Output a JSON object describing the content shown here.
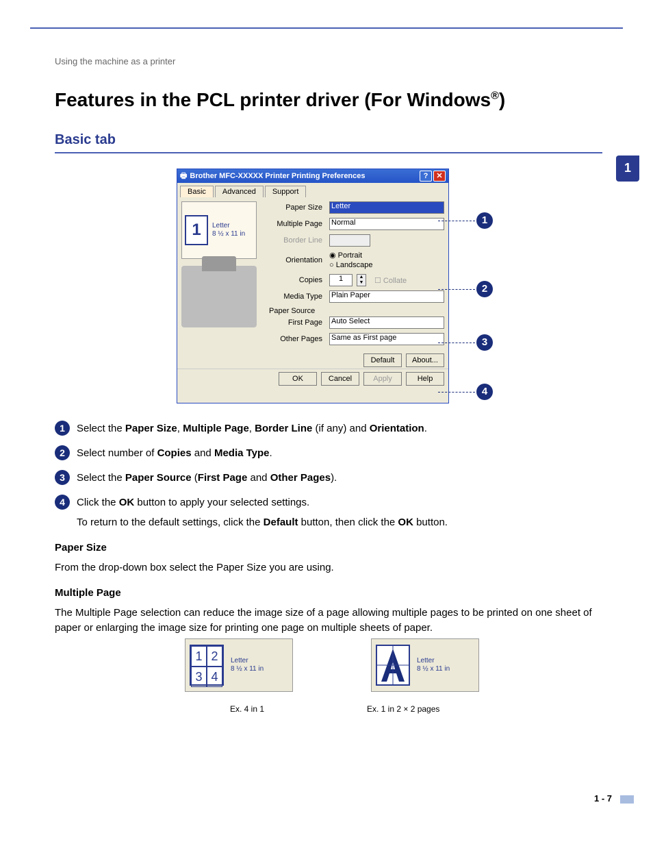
{
  "breadcrumb": "Using the machine as a printer",
  "title_pre": "Features in the PCL printer driver (For Windows",
  "title_sup": "®",
  "title_post": ")",
  "section_heading": "Basic tab",
  "side_tab": "1",
  "dialog": {
    "title": "Brother MFC-XXXXX Printer Printing Preferences",
    "tabs": {
      "basic": "Basic",
      "advanced": "Advanced",
      "support": "Support"
    },
    "preview": {
      "label": "Letter",
      "size": "8 ½ x 11 in",
      "num": "1"
    },
    "paper_size": {
      "label": "Paper Size",
      "value": "Letter"
    },
    "multiple_page": {
      "label": "Multiple Page",
      "value": "Normal"
    },
    "border_line": {
      "label": "Border Line",
      "value": ""
    },
    "orientation": {
      "label": "Orientation",
      "portrait": "Portrait",
      "landscape": "Landscape"
    },
    "copies": {
      "label": "Copies",
      "value": "1",
      "collate": "Collate"
    },
    "media_type": {
      "label": "Media Type",
      "value": "Plain Paper"
    },
    "paper_source": {
      "header": "Paper Source",
      "first_page_label": "First Page",
      "first_page_value": "Auto Select",
      "other_pages_label": "Other Pages",
      "other_pages_value": "Same as First page"
    },
    "buttons": {
      "default": "Default",
      "about": "About...",
      "ok": "OK",
      "cancel": "Cancel",
      "apply": "Apply",
      "help": "Help"
    }
  },
  "callouts": {
    "c1": "1",
    "c2": "2",
    "c3": "3",
    "c4": "4"
  },
  "instructions": {
    "i1_pre": "Select the ",
    "i1_b1": "Paper Size",
    "i1_s1": ", ",
    "i1_b2": "Multiple Page",
    "i1_s2": ", ",
    "i1_b3": "Border Line",
    "i1_s3": " (if any) and ",
    "i1_b4": "Orientation",
    "i1_s4": ".",
    "i2_pre": "Select number of ",
    "i2_b1": "Copies",
    "i2_s1": " and ",
    "i2_b2": "Media Type",
    "i2_s2": ".",
    "i3_pre": "Select the ",
    "i3_b1": "Paper Source",
    "i3_s1": " (",
    "i3_b2": "First Page",
    "i3_s2": " and ",
    "i3_b3": "Other Pages",
    "i3_s3": ").",
    "i4_pre": "Click the ",
    "i4_b1": "OK",
    "i4_s1": " button to apply your selected settings.",
    "i4_sub_pre": "To return to the default settings, click the ",
    "i4_sub_b1": "Default",
    "i4_sub_s1": " button, then click the ",
    "i4_sub_b2": "OK",
    "i4_sub_s2": " button."
  },
  "paper_size_head": "Paper Size",
  "paper_size_body": "From the drop-down box select the Paper Size you are using.",
  "multiple_page_head": "Multiple Page",
  "multiple_page_body": "The Multiple Page selection can reduce the image size of a page allowing multiple pages to be printed on one sheet of paper or enlarging the image size for printing one page on multiple sheets of paper.",
  "examples": {
    "ex1": {
      "g1": "1",
      "g2": "2",
      "g3": "3",
      "g4": "4",
      "label": "Letter",
      "size": "8 ½ x 11 in",
      "caption": "Ex. 4 in 1"
    },
    "ex2": {
      "label": "Letter",
      "size": "8 ½ x 11 in",
      "caption": "Ex. 1 in 2 × 2 pages"
    }
  },
  "footer": "1 - 7"
}
